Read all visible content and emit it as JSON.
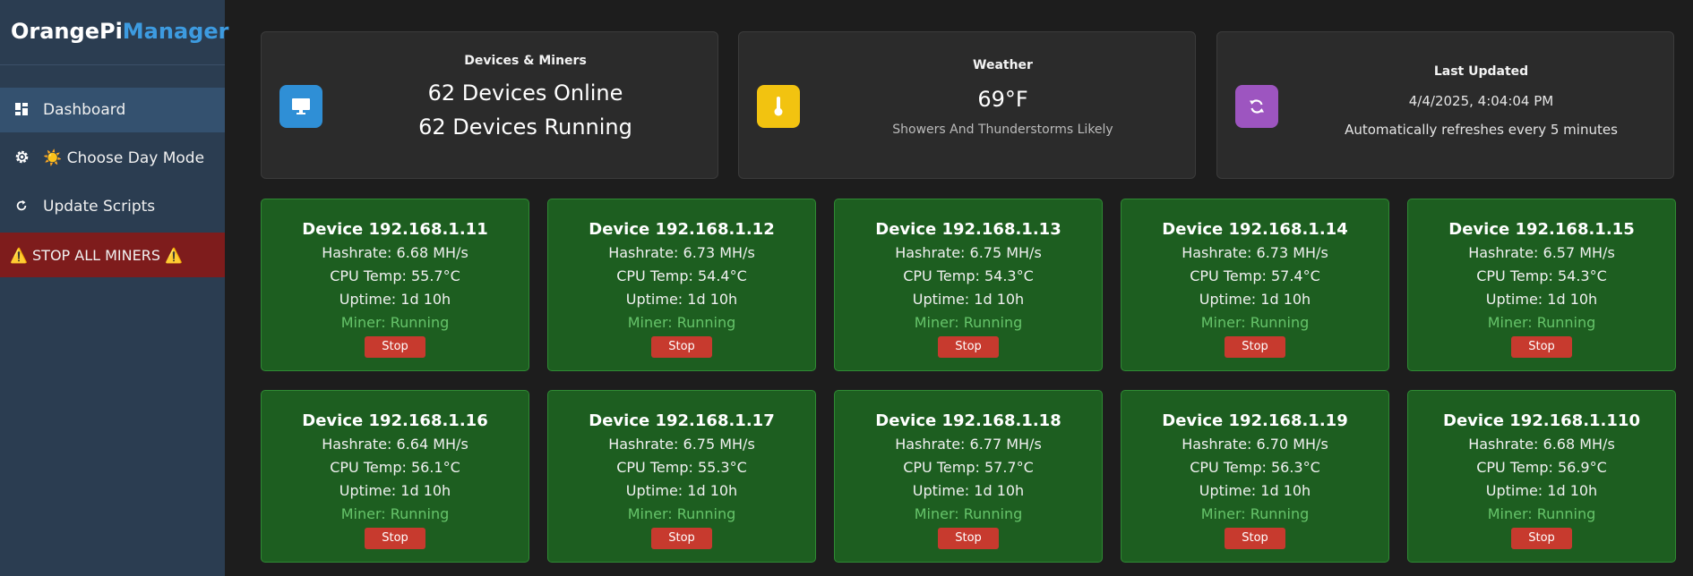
{
  "sidebar": {
    "logo_part1": "OrangePi",
    "logo_part2": "Manager",
    "items": [
      {
        "label": "Dashboard"
      },
      {
        "label": "☀️ Choose Day Mode"
      },
      {
        "label": "Update Scripts"
      },
      {
        "label": "⚠️ STOP ALL MINERS ⚠️"
      }
    ]
  },
  "summary": {
    "devices": {
      "title": "Devices & Miners",
      "online": "62 Devices Online",
      "running": "62 Devices Running"
    },
    "weather": {
      "title": "Weather",
      "temp": "69°F",
      "desc": "Showers And Thunderstorms Likely"
    },
    "updated": {
      "title": "Last Updated",
      "time": "4/4/2025, 4:04:04 PM",
      "note": "Automatically refreshes every 5 minutes"
    }
  },
  "colors": {
    "devices_icon": "#2f8fd6",
    "weather_icon": "#f2c310",
    "updated_icon": "#9d55c0",
    "card_bg": "#1d5e20",
    "stop_button": "#c73a2e"
  },
  "devices": [
    {
      "title": "Device 192.168.1.11",
      "hashrate": "Hashrate: 6.68 MH/s",
      "temp": "CPU Temp: 55.7°C",
      "uptime": "Uptime: 1d 10h",
      "status": "Miner: Running",
      "button": "Stop"
    },
    {
      "title": "Device 192.168.1.12",
      "hashrate": "Hashrate: 6.73 MH/s",
      "temp": "CPU Temp: 54.4°C",
      "uptime": "Uptime: 1d 10h",
      "status": "Miner: Running",
      "button": "Stop"
    },
    {
      "title": "Device 192.168.1.13",
      "hashrate": "Hashrate: 6.75 MH/s",
      "temp": "CPU Temp: 54.3°C",
      "uptime": "Uptime: 1d 10h",
      "status": "Miner: Running",
      "button": "Stop"
    },
    {
      "title": "Device 192.168.1.14",
      "hashrate": "Hashrate: 6.73 MH/s",
      "temp": "CPU Temp: 57.4°C",
      "uptime": "Uptime: 1d 10h",
      "status": "Miner: Running",
      "button": "Stop"
    },
    {
      "title": "Device 192.168.1.15",
      "hashrate": "Hashrate: 6.57 MH/s",
      "temp": "CPU Temp: 54.3°C",
      "uptime": "Uptime: 1d 10h",
      "status": "Miner: Running",
      "button": "Stop"
    },
    {
      "title": "Device 192.168.1.16",
      "hashrate": "Hashrate: 6.64 MH/s",
      "temp": "CPU Temp: 56.1°C",
      "uptime": "Uptime: 1d 10h",
      "status": "Miner: Running",
      "button": "Stop"
    },
    {
      "title": "Device 192.168.1.17",
      "hashrate": "Hashrate: 6.75 MH/s",
      "temp": "CPU Temp: 55.3°C",
      "uptime": "Uptime: 1d 10h",
      "status": "Miner: Running",
      "button": "Stop"
    },
    {
      "title": "Device 192.168.1.18",
      "hashrate": "Hashrate: 6.77 MH/s",
      "temp": "CPU Temp: 57.7°C",
      "uptime": "Uptime: 1d 10h",
      "status": "Miner: Running",
      "button": "Stop"
    },
    {
      "title": "Device 192.168.1.19",
      "hashrate": "Hashrate: 6.70 MH/s",
      "temp": "CPU Temp: 56.3°C",
      "uptime": "Uptime: 1d 10h",
      "status": "Miner: Running",
      "button": "Stop"
    },
    {
      "title": "Device 192.168.1.110",
      "hashrate": "Hashrate: 6.68 MH/s",
      "temp": "CPU Temp: 56.9°C",
      "uptime": "Uptime: 1d 10h",
      "status": "Miner: Running",
      "button": "Stop"
    }
  ]
}
